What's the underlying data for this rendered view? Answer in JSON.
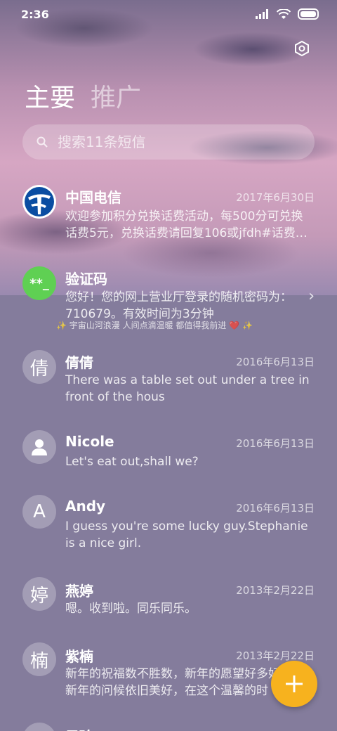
{
  "status_bar": {
    "time": "2:36"
  },
  "tabs": {
    "primary": "主要",
    "secondary": "推广"
  },
  "search": {
    "placeholder": "搜索11条短信"
  },
  "threads": [
    {
      "name": "中国电信",
      "date": "2017年6月30日",
      "line1": "欢迎参加积分兑换话费活动，每500分可兑换",
      "line2": "话费5元，兑换话费请回复106或jfdh#话费…"
    },
    {
      "name": "验证码",
      "avatar": "**_",
      "line1": "您好！您的网上营业厅登录的随机密码为：",
      "line2": "710679。有效时间为3分钟"
    },
    {
      "name": "倩倩",
      "avatar": "倩",
      "date": "2016年6月13日",
      "line1": "There was a table set out under a tree in",
      "line2": "front of the hous"
    },
    {
      "name": "Nicole",
      "date": "2016年6月13日",
      "line1": "Let's eat out,shall we?"
    },
    {
      "name": "Andy",
      "avatar": "A",
      "date": "2016年6月13日",
      "line1": "I guess you're some lucky guy.Stephanie",
      "line2": "is a nice girl."
    },
    {
      "name": "燕婷",
      "avatar": "婷",
      "date": "2013年2月22日",
      "line1": "嗯。收到啦。同乐同乐。"
    },
    {
      "name": "紫楠",
      "avatar": "楠",
      "date": "2013年2月22日",
      "line1": "新年的祝福数不胜数，新年的愿望好多好多",
      "line2": "新年的问候依旧美好，在这个温馨的时"
    },
    {
      "name": "子玲"
    }
  ],
  "ad_banner": "✨ 宇宙山河浪漫 人间点滴温暖 都值得我前进 ❤️ ✨",
  "colors": {
    "fab": "#f7b21e",
    "verify_avatar": "#5fd053",
    "telecom_blue": "#0a4da2"
  },
  "icons": [
    "settings-icon",
    "search-icon",
    "chevron-right-icon",
    "contact-person-icon",
    "add-icon"
  ]
}
